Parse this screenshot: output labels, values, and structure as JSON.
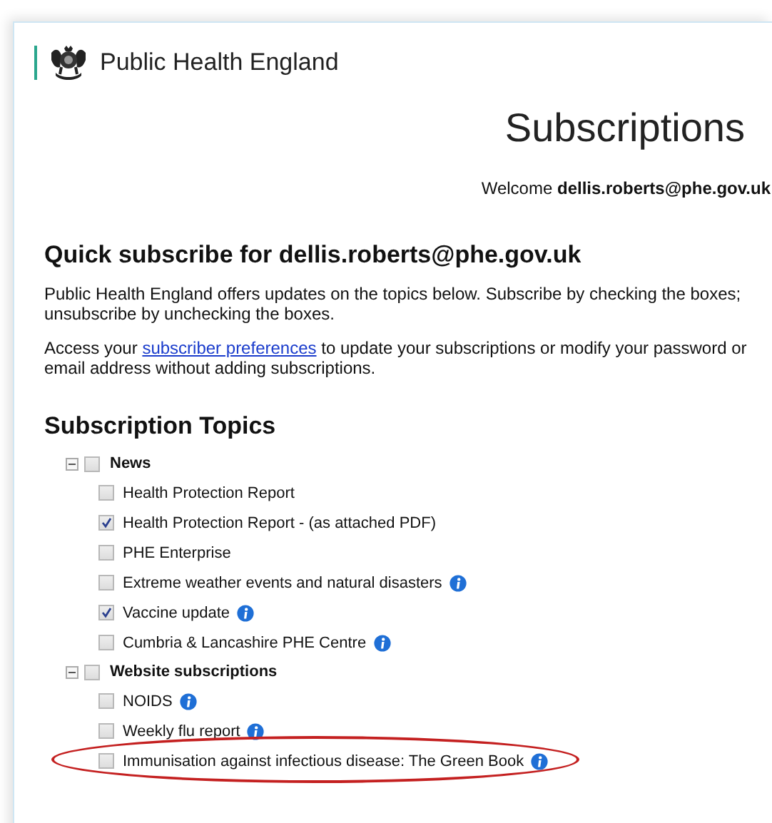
{
  "header": {
    "logo_text": "Public Health England"
  },
  "page_title": "Subscriptions",
  "welcome": "Welcome **dellis.roberts@phe.gov.uk**",
  "quick_subscribe": {
    "heading": "Quick subscribe for dellis.roberts@phe.gov.uk",
    "intro": "Public Health England offers updates on the topics below. Subscribe by checking the boxes; unsubscribe by unchecking the boxes.",
    "access_before": "Access your",
    "access_link": "subscriber preferences",
    "access_after": "to update your subscriptions or modify your password or email address without adding subscriptions."
  },
  "topics": {
    "heading": "Subscription Topics",
    "groups": [
      {
        "label": "News",
        "expanded": true,
        "checked": false,
        "children": [
          {
            "label": "Health Protection Report",
            "checked": false,
            "info": false,
            "highlighted": false
          },
          {
            "label": "Health Protection Report - (as attached PDF)",
            "checked": true,
            "info": false,
            "highlighted": false
          },
          {
            "label": "PHE Enterprise",
            "checked": false,
            "info": false,
            "highlighted": false
          },
          {
            "label": "Extreme weather events and natural disasters",
            "checked": false,
            "info": true,
            "highlighted": false
          },
          {
            "label": "Vaccine update",
            "checked": true,
            "info": true,
            "highlighted": false
          },
          {
            "label": "Cumbria & Lancashire PHE Centre",
            "checked": false,
            "info": true,
            "highlighted": false
          }
        ]
      },
      {
        "label": "Website subscriptions",
        "expanded": true,
        "checked": false,
        "children": [
          {
            "label": "NOIDS",
            "checked": false,
            "info": true,
            "highlighted": false
          },
          {
            "label": "Weekly flu report",
            "checked": false,
            "info": true,
            "highlighted": false
          },
          {
            "label": "Immunisation against infectious disease: The Green Book",
            "checked": false,
            "info": true,
            "highlighted": true
          }
        ]
      }
    ]
  }
}
